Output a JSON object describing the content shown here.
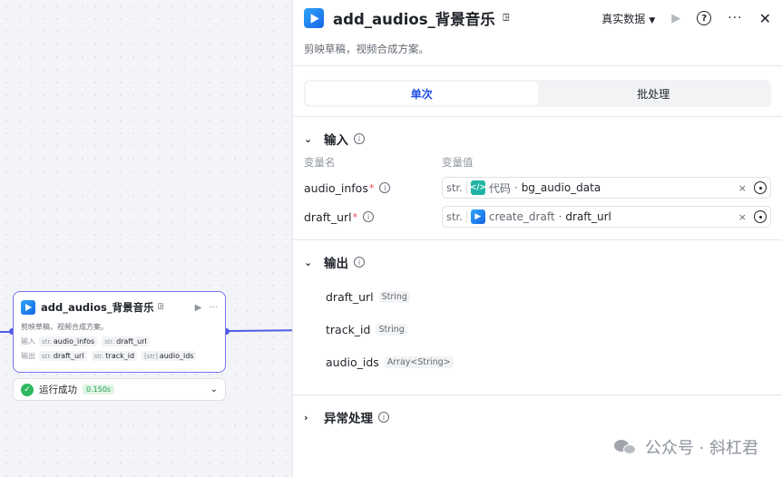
{
  "canvas": {
    "node": {
      "title": "add_audios_背景音乐",
      "badge": "ꖸ",
      "desc": "剪映草稿，视频合成方案。",
      "input_label": "输入",
      "inputs": [
        {
          "type": "str.",
          "name": "audio_infos"
        },
        {
          "type": "str.",
          "name": "draft_url"
        }
      ],
      "output_label": "输出",
      "outputs": [
        {
          "type": "str.",
          "name": "draft_url"
        },
        {
          "type": "str.",
          "name": "track_id"
        },
        {
          "type": "[str]",
          "name": "audio_ids"
        }
      ]
    },
    "run": {
      "status": "运行成功",
      "time": "0.150s"
    }
  },
  "panel": {
    "title": "add_audios_背景音乐",
    "title_badge": "ꖸ",
    "data_mode": "真实数据",
    "desc": "剪映草稿，视频合成方案。",
    "tabs": [
      "单次",
      "批处理"
    ],
    "input_section": {
      "title": "输入",
      "col_name": "变量名",
      "col_value": "变量值",
      "vars": [
        {
          "name": "audio_infos",
          "type": "str.",
          "ref_node": "代码",
          "ref_var": "bg_audio_data"
        },
        {
          "name": "draft_url",
          "type": "str.",
          "ref_node": "create_draft",
          "ref_var": "draft_url"
        }
      ]
    },
    "output_section": {
      "title": "输出",
      "vars": [
        {
          "name": "draft_url",
          "type": "String"
        },
        {
          "name": "track_id",
          "type": "String"
        },
        {
          "name": "audio_ids",
          "type": "Array<String>"
        }
      ]
    },
    "error_section": {
      "title": "异常处理"
    }
  },
  "watermark": "公众号 · 斜杠君",
  "icons": {
    "node_logo": "capcut-play-icon",
    "code_node": "code-brackets-icon",
    "draft_node": "capcut-play-icon"
  },
  "colors": {
    "accent": "#1f4ce6",
    "edge": "#4e5de8",
    "success": "#2fb860",
    "node_border": "#7a73f0"
  }
}
